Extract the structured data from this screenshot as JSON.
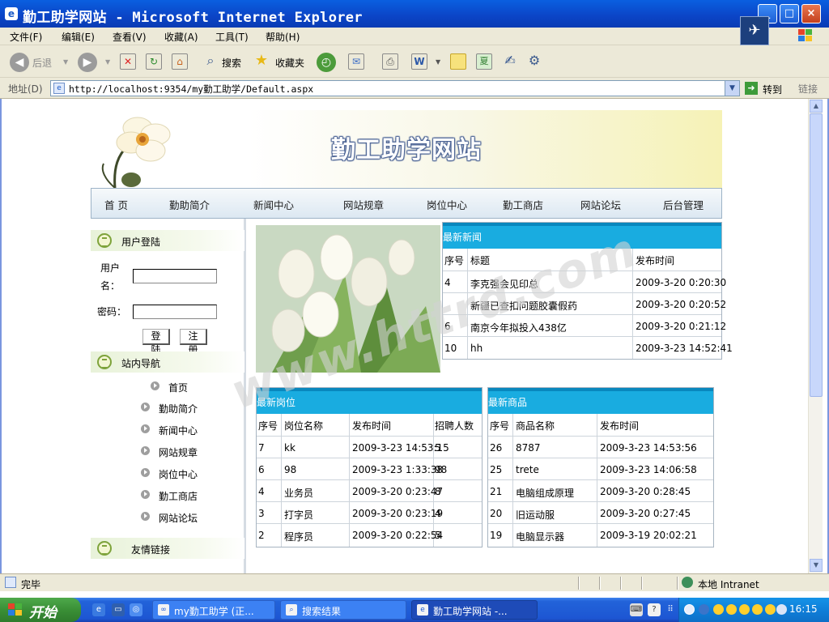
{
  "window": {
    "title": "勤工助学网站 - Microsoft Internet Explorer",
    "buttons": [
      "_",
      "□",
      "×"
    ]
  },
  "menubar": [
    "文件(F)",
    "编辑(E)",
    "查看(V)",
    "收藏(A)",
    "工具(T)",
    "帮助(H)"
  ],
  "toolbar": {
    "back": "后退",
    "search": "搜索",
    "favorites": "收藏夹"
  },
  "address": {
    "label": "地址(D)",
    "url": "http://localhost:9354/my勤工助学/Default.aspx",
    "go": "转到",
    "links": "链接"
  },
  "site": {
    "title": "勤工助学网站",
    "nav": [
      "首 页",
      "勤助简介",
      "新闻中心",
      "网站规章",
      "岗位中心",
      "勤工商店",
      "网站论坛",
      "后台管理"
    ]
  },
  "login": {
    "heading": "用户登陆",
    "username_label_line1": "用户",
    "username_label_line2": "名：",
    "password_label": "密码：",
    "username_value": "",
    "password_value": "",
    "login_button": "登陆",
    "register_button": "注册"
  },
  "sitenav": {
    "heading": "站内导航",
    "items": [
      "首页",
      "勤助简介",
      "新闻中心",
      "网站规章",
      "岗位中心",
      "勤工商店",
      "网站论坛"
    ]
  },
  "links_section": {
    "heading": "友情链接"
  },
  "news": {
    "heading": "最新新闻",
    "columns": [
      "序号",
      "标题",
      "发布时间"
    ],
    "rows": [
      {
        "id": "4",
        "title": "李克强会见印总",
        "time": "2009-3-20 0:20:30"
      },
      {
        "id": "",
        "title": "新疆已查扣问题胶囊假药",
        "time": "2009-3-20 0:20:52"
      },
      {
        "id": "6",
        "title": "南京今年拟投入438亿",
        "time": "2009-3-20 0:21:12"
      },
      {
        "id": "10",
        "title": "hh",
        "time": "2009-3-23 14:52:41"
      }
    ]
  },
  "jobs": {
    "heading": "最新岗位",
    "columns": [
      "序号",
      "岗位名称",
      "发布时间",
      "招聘人数"
    ],
    "rows": [
      {
        "id": "7",
        "name": "kk",
        "time": "2009-3-23 14:53:15",
        "count": "5"
      },
      {
        "id": "6",
        "name": "98",
        "time": "2009-3-23 1:33:38",
        "count": "98"
      },
      {
        "id": "4",
        "name": "业务员",
        "time": "2009-3-20 0:23:47",
        "count": "8"
      },
      {
        "id": "3",
        "name": "打字员",
        "time": "2009-3-20 0:23:19",
        "count": "4"
      },
      {
        "id": "2",
        "name": "程序员",
        "time": "2009-3-20 0:22:54",
        "count": "5"
      }
    ]
  },
  "goods": {
    "heading": "最新商品",
    "columns": [
      "序号",
      "商品名称",
      "发布时间"
    ],
    "rows": [
      {
        "id": "26",
        "name": "8787",
        "time": "2009-3-23 14:53:56"
      },
      {
        "id": "25",
        "name": "trete",
        "time": "2009-3-23 14:06:58"
      },
      {
        "id": "21",
        "name": "电脑组成原理",
        "time": "2009-3-20 0:28:45"
      },
      {
        "id": "20",
        "name": "旧运动服",
        "time": "2009-3-20 0:27:45"
      },
      {
        "id": "19",
        "name": "电脑显示器",
        "time": "2009-3-19 20:02:21"
      }
    ]
  },
  "watermark": "www.httrd.com",
  "statusbar": {
    "status": "完毕",
    "zone": "本地 Intranet"
  },
  "taskbar": {
    "start": "开始",
    "tasks": [
      "my勤工助学 (正...",
      "搜索结果",
      "勤工助学网站 -..."
    ],
    "clock": "16:15"
  },
  "colors": {
    "title_bar": "#0b44c6",
    "panel_header": "#19ace0",
    "taskbar": "#1d56d3",
    "start_button": "#3a8f36"
  }
}
